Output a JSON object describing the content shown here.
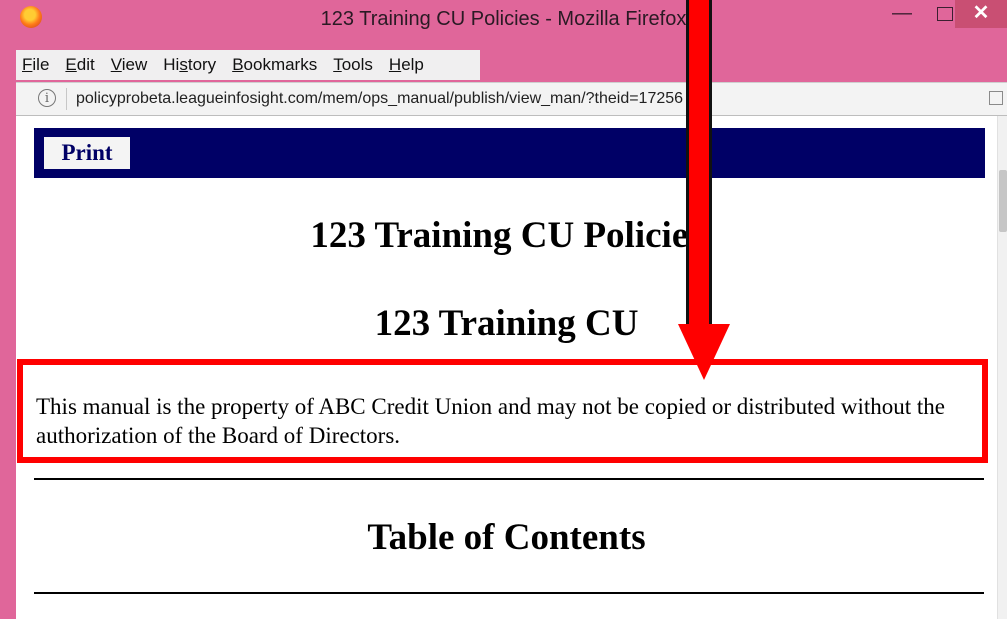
{
  "window": {
    "title": "123 Training CU Policies - Mozilla Firefox",
    "minimize_glyph": "—",
    "close_glyph": "✕"
  },
  "menubar": {
    "items": [
      {
        "pre": "",
        "acc": "F",
        "post": "ile"
      },
      {
        "pre": "",
        "acc": "E",
        "post": "dit"
      },
      {
        "pre": "",
        "acc": "V",
        "post": "iew"
      },
      {
        "pre": "Hi",
        "acc": "s",
        "post": "tory"
      },
      {
        "pre": "",
        "acc": "B",
        "post": "ookmarks"
      },
      {
        "pre": "",
        "acc": "T",
        "post": "ools"
      },
      {
        "pre": "",
        "acc": "H",
        "post": "elp"
      }
    ]
  },
  "urlbar": {
    "info_glyph": "i",
    "url": "policyprobeta.leagueinfosight.com/mem/ops_manual/publish/view_man/?theid=17256"
  },
  "page": {
    "print_label": "Print",
    "manual_title": "123 Training CU Policies",
    "cu_name": "123 Training CU",
    "notice": "This manual is the property of ABC Credit Union and may not be copied or distributed without the authorization of the Board of Directors.",
    "toc_heading": "Table of Contents"
  },
  "colors": {
    "window_frame": "#e0669a",
    "print_bar": "#000066",
    "annotation": "#ff0000"
  },
  "icons": [
    "firefox-logo-icon",
    "minimize-icon",
    "maximize-icon",
    "close-icon",
    "info-icon",
    "reader-view-icon",
    "annotation-arrow"
  ]
}
